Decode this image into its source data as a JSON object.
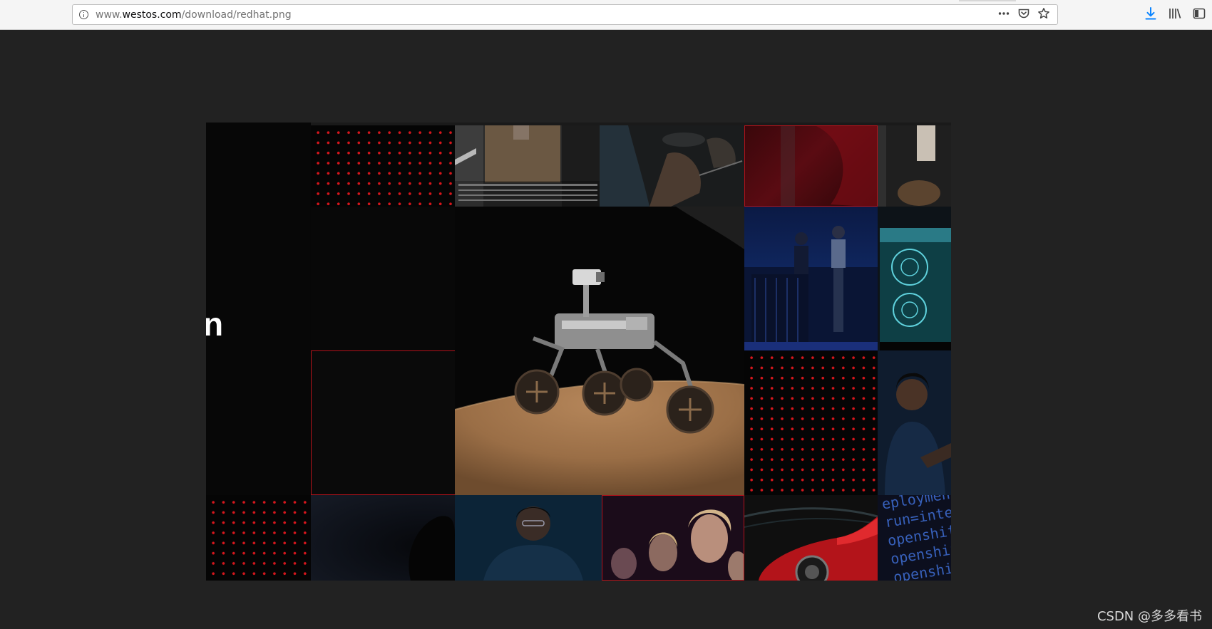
{
  "browser": {
    "url_host_prefix": "www.",
    "url_host": "westos.com",
    "url_path": "/download/redhat.png",
    "icons": {
      "site_info": "info-icon",
      "page_actions": "more-actions-icon",
      "pocket": "pocket-icon",
      "bookmark": "bookmark-star-icon",
      "downloads": "download-arrow-icon",
      "library": "library-icon",
      "sidebar": "sidebar-icon"
    },
    "accent_color": "#0a84ff"
  },
  "image": {
    "hero_fragment": "n",
    "code_lines": [
      "eployment",
      "run=integr",
      "openshift.",
      "openshift",
      "openshi"
    ],
    "accent_red": "#d8161c",
    "tiles": [
      {
        "name": "red-dot-pattern"
      },
      {
        "name": "cardboard-box-conveyor-photo"
      },
      {
        "name": "hands-workbench-photo"
      },
      {
        "name": "red-abstract-photo"
      },
      {
        "name": "machine-part-photo"
      },
      {
        "name": "mars-rover-model-photo"
      },
      {
        "name": "stage-presenters-photo"
      },
      {
        "name": "brain-scan-monitor-photo"
      },
      {
        "name": "woman-portrait-photo"
      },
      {
        "name": "man-at-laptop-photo"
      },
      {
        "name": "audience-photo"
      },
      {
        "name": "red-sports-car-photo"
      },
      {
        "name": "code-screen-photo"
      }
    ]
  },
  "watermark": "CSDN @多多看书"
}
